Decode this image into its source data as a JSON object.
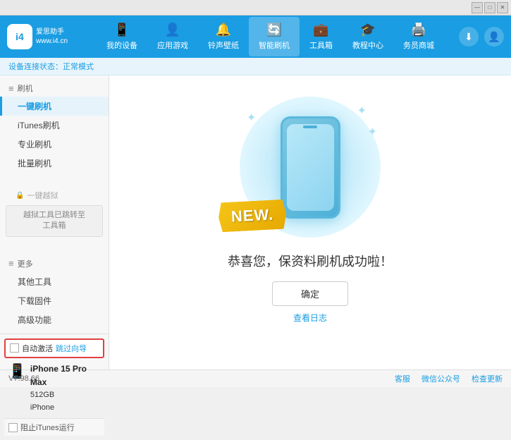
{
  "app": {
    "logo_text": "爱思助手\nwww.i4.cn",
    "logo_abbr": "i4"
  },
  "topbar": {
    "minimize": "—",
    "maximize": "□",
    "close": "✕"
  },
  "nav": {
    "items": [
      {
        "id": "my-device",
        "label": "我的设备",
        "icon": "📱"
      },
      {
        "id": "app-game",
        "label": "应用游戏",
        "icon": "👤"
      },
      {
        "id": "ringtone",
        "label": "铃声壁纸",
        "icon": "🔔"
      },
      {
        "id": "smart-flash",
        "label": "智能刷机",
        "icon": "🔄"
      },
      {
        "id": "toolbox",
        "label": "工具箱",
        "icon": "💼"
      },
      {
        "id": "tutorial",
        "label": "教程中心",
        "icon": "🎓"
      },
      {
        "id": "service",
        "label": "务员商城",
        "icon": "🖨️"
      }
    ]
  },
  "status": {
    "prefix": "设备连接状态：",
    "value": "正常模式"
  },
  "sidebar": {
    "flash_section": "刷机",
    "items": [
      {
        "id": "one-key-flash",
        "label": "一键刷机",
        "active": true
      },
      {
        "id": "itunes-flash",
        "label": "iTunes刷机",
        "active": false
      },
      {
        "id": "pro-flash",
        "label": "专业刷机",
        "active": false
      },
      {
        "id": "batch-flash",
        "label": "批量刷机",
        "active": false
      }
    ],
    "jailbreak_section": "一键越狱",
    "jailbreak_disabled_text": "越狱工具已跳转至\n工具箱",
    "more_section": "更多",
    "more_items": [
      {
        "id": "other-tools",
        "label": "其他工具"
      },
      {
        "id": "download-firm",
        "label": "下载固件"
      },
      {
        "id": "advanced",
        "label": "高级功能"
      }
    ],
    "auto_activate": "自动激活",
    "guide": "跳过向导",
    "device_name": "iPhone 15 Pro Max",
    "device_storage": "512GB",
    "device_type": "iPhone",
    "block_itunes": "阻止iTunes运行"
  },
  "content": {
    "new_badge": "NEW.",
    "success_text": "恭喜您，保资料刷机成功啦！",
    "confirm_btn": "确定",
    "log_link": "查看日志"
  },
  "footer": {
    "version": "V7.98.66",
    "links": [
      {
        "id": "client",
        "label": "客服"
      },
      {
        "id": "wechat",
        "label": "微信公众号"
      },
      {
        "id": "check-update",
        "label": "检查更新"
      }
    ]
  }
}
